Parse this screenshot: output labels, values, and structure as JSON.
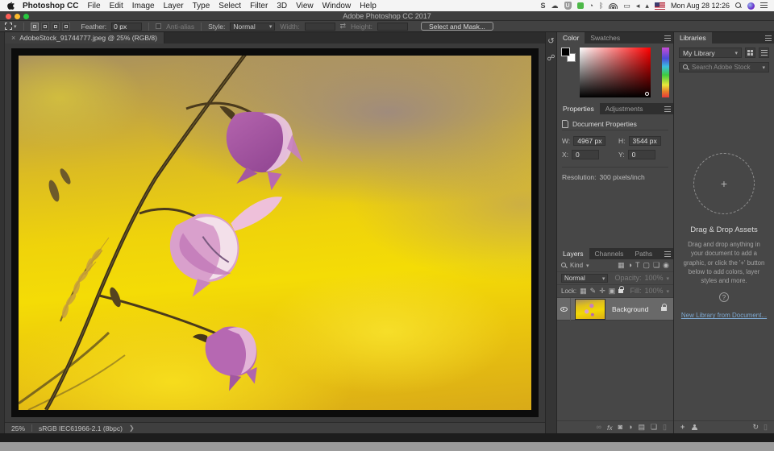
{
  "menu_bar": {
    "items": [
      "Photoshop CC",
      "File",
      "Edit",
      "Image",
      "Layer",
      "Type",
      "Select",
      "Filter",
      "3D",
      "View",
      "Window",
      "Help"
    ],
    "status": {
      "s_label": "S",
      "shield_label": "U"
    },
    "clock": "Mon Aug 28 12:26"
  },
  "title_bar": {
    "title": "Adobe Photoshop CC 2017"
  },
  "options_bar": {
    "feather_label": "Feather:",
    "feather_value": "0 px",
    "anti_alias_label": "Anti-alias",
    "style_label": "Style:",
    "style_value": "Normal",
    "width_label": "Width:",
    "swap_glyph": "⇄",
    "height_label": "Height:",
    "select_mask_label": "Select and Mask..."
  },
  "document": {
    "tab_title": "AdobeStock_91744777.jpeg @ 25% (RGB/8)",
    "close_glyph": "×",
    "zoom_level": "25%",
    "color_profile": "sRGB IEC61966-2.1 (8bpc)",
    "status_chevron": "❯"
  },
  "panels": {
    "color": {
      "tabs": [
        "Color",
        "Swatches"
      ]
    },
    "properties": {
      "tabs": [
        "Properties",
        "Adjustments"
      ],
      "header": "Document Properties",
      "w_label": "W:",
      "w_value": "4967 px",
      "h_label": "H:",
      "h_value": "3544 px",
      "x_label": "X:",
      "x_value": "0",
      "y_label": "Y:",
      "y_value": "0",
      "res_label": "Resolution:",
      "res_value": "300 pixels/inch"
    },
    "layers": {
      "tabs": [
        "Layers",
        "Channels",
        "Paths"
      ],
      "kind_label": "Kind",
      "blend_mode": "Normal",
      "opacity_label": "Opacity:",
      "opacity_value": "100%",
      "lock_label": "Lock:",
      "fill_label": "Fill:",
      "fill_value": "100%",
      "layer_name": "Background",
      "fx_label": "fx"
    },
    "libraries": {
      "tab": "Libraries",
      "library_select": "My Library",
      "search_placeholder": "Search Adobe Stock",
      "plus_glyph": "+",
      "empty_title": "Drag & Drop Assets",
      "empty_body": "Drag and drop anything in your document to add a graphic, or click the '+' button below to add colors, layer styles and more.",
      "help_glyph": "?",
      "new_library_link": "New Library from Document..."
    }
  },
  "colors": {
    "panel_bg": "#474747",
    "canvas_bg": "#3a3a3a",
    "selected_layer_bg": "#696969",
    "traffic_red": "#ff5f57",
    "traffic_yellow": "#febc2e",
    "traffic_green": "#28c840",
    "link_blue": "#7da7cf"
  }
}
